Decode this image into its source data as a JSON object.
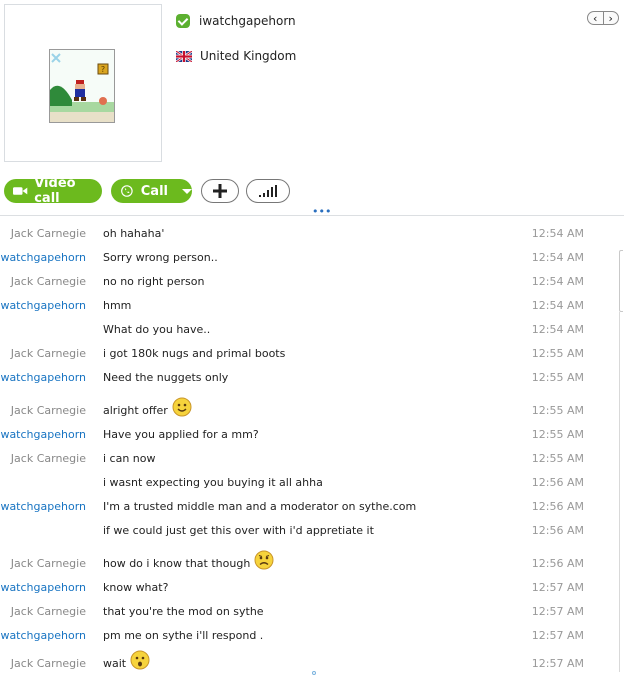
{
  "profile": {
    "username": "iwatchgapehorn",
    "location": "United Kingdom",
    "presence_icon": "online-check-icon",
    "flag_icon": "uk-flag-icon",
    "avatar_icon": "pixel-game-avatar"
  },
  "nav": {
    "prev": "‹",
    "next": "›"
  },
  "actions": {
    "video_call_label": "Video call",
    "call_label": "Call",
    "add_icon": "plus-icon",
    "signal_icon": "signal-bars-icon"
  },
  "colors": {
    "accent_green": "#6cba1e",
    "my_name": "#1874c2",
    "their_name": "#888888",
    "timestamp": "#999999"
  },
  "messages": [
    {
      "sender": "Jack Carnegie",
      "me": false,
      "text": "oh hahaha'",
      "time": "12:54 AM"
    },
    {
      "sender": "Iwatchgapehorn",
      "me": true,
      "text": "Sorry wrong person..",
      "time": "12:54 AM"
    },
    {
      "sender": "Jack Carnegie",
      "me": false,
      "text": "no no right person",
      "time": "12:54 AM"
    },
    {
      "sender": "Iwatchgapehorn",
      "me": true,
      "text": "hmm",
      "time": "12:54 AM"
    },
    {
      "sender": "",
      "me": true,
      "text": "What do you have..",
      "time": "12:54 AM"
    },
    {
      "sender": "Jack Carnegie",
      "me": false,
      "text": "i got 180k nugs and primal boots",
      "time": "12:55 AM"
    },
    {
      "sender": "Iwatchgapehorn",
      "me": true,
      "text": "Need the nuggets only",
      "time": "12:55 AM"
    },
    {
      "sender": "Jack Carnegie",
      "me": false,
      "text": "alright offer",
      "time": "12:55 AM",
      "emoticon": "smile-emoticon-icon"
    },
    {
      "sender": "Iwatchgapehorn",
      "me": true,
      "text": "Have you applied for a mm?",
      "time": "12:55 AM"
    },
    {
      "sender": "Jack Carnegie",
      "me": false,
      "text": "i can now",
      "time": "12:55 AM"
    },
    {
      "sender": "",
      "me": false,
      "text": "i wasnt expecting you buying it all ahha",
      "time": "12:56 AM"
    },
    {
      "sender": "Iwatchgapehorn",
      "me": true,
      "text": "I'm a trusted middle man and a moderator on sythe.com",
      "time": "12:56 AM"
    },
    {
      "sender": "",
      "me": true,
      "text": "if we could just get this over with i'd appretiate it",
      "time": "12:56 AM"
    },
    {
      "sender": "Jack Carnegie",
      "me": false,
      "text": "how do i know that though",
      "time": "12:56 AM",
      "emoticon": "worried-emoticon-icon"
    },
    {
      "sender": "Iwatchgapehorn",
      "me": true,
      "text": "know what?",
      "time": "12:57 AM"
    },
    {
      "sender": "Jack Carnegie",
      "me": false,
      "text": "that you're the mod on sythe",
      "time": "12:57 AM"
    },
    {
      "sender": "Iwatchgapehorn",
      "me": true,
      "text": "pm me on sythe i'll respond .",
      "time": "12:57 AM"
    },
    {
      "sender": "Jack Carnegie",
      "me": false,
      "text": "wait",
      "time": "12:57 AM",
      "emoticon": "surprised-emoticon-icon"
    }
  ]
}
